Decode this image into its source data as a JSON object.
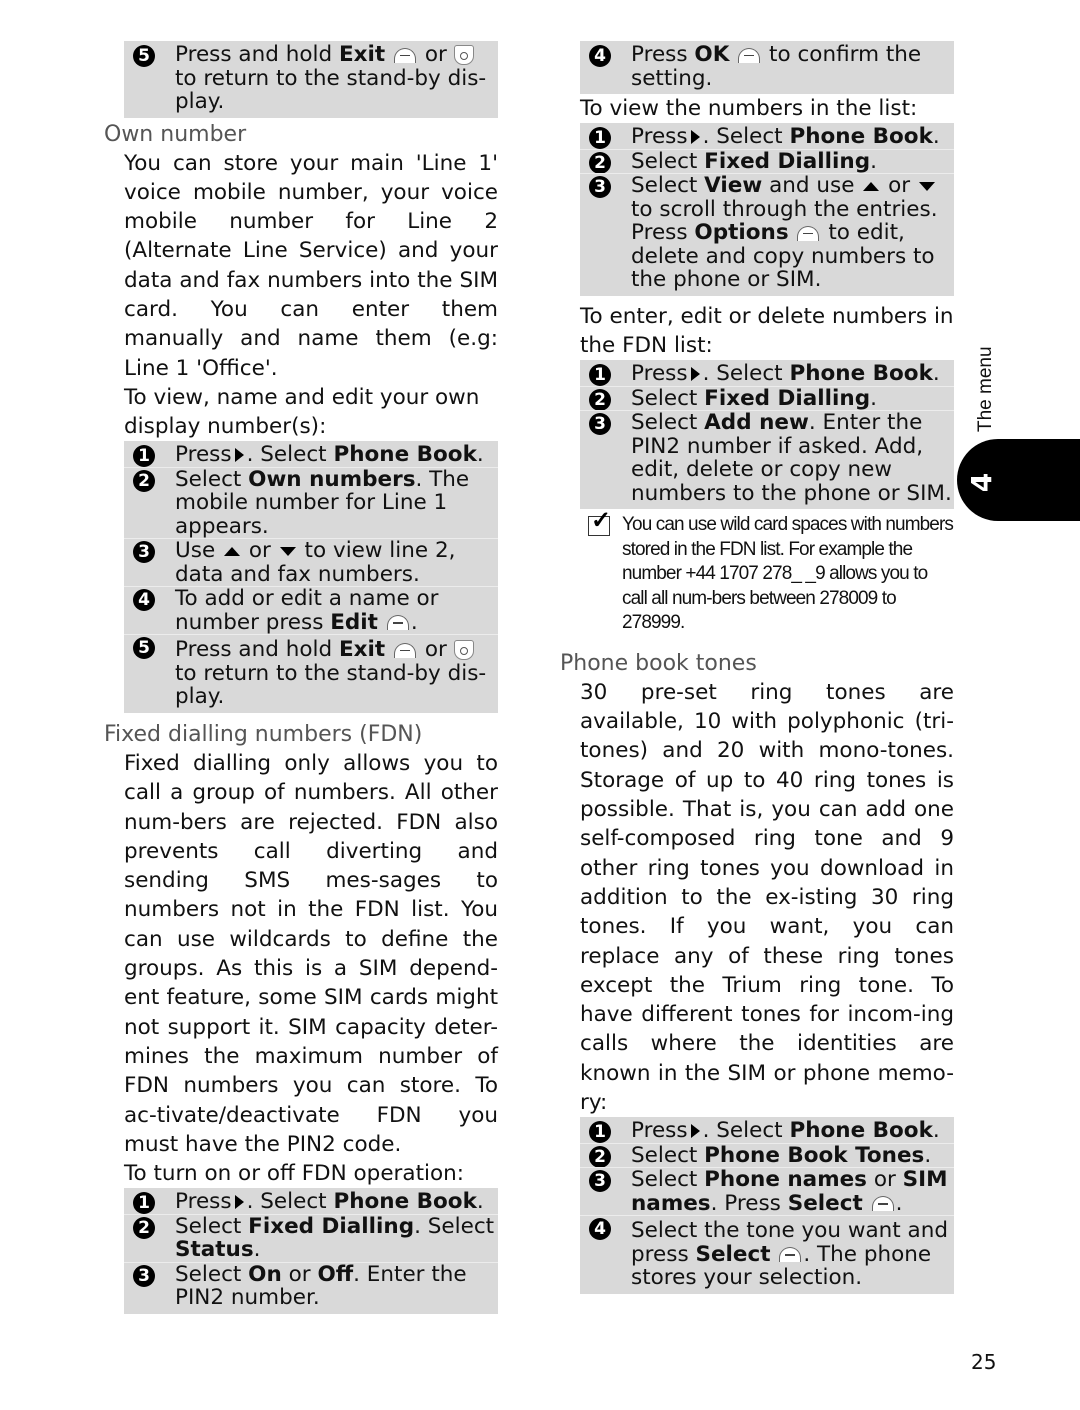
{
  "page_number": "25",
  "side_tab": {
    "label": "The menu",
    "chapter": "4"
  },
  "left": {
    "top_box": {
      "steps": [
        {
          "n": "5",
          "parts": [
            "Press and hold ",
            "Exit",
            " ",
            "or",
            " to return to the stand-by dis-play."
          ]
        }
      ]
    },
    "own_number": {
      "heading": "Own number",
      "para1": "You can store your main 'Line 1' voice mobile number, your voice mobile number for Line 2 (Alternate Line Service) and your data and fax numbers into the SIM card. You can enter them manually and name them (e.g: Line 1 'Office'.",
      "para2": "To view, name and edit your own display number(s):",
      "steps": {
        "s1": {
          "n": "1",
          "a": "Press",
          "b": ". Select ",
          "bold": "Phone Book",
          "c": "."
        },
        "s2": {
          "n": "2",
          "a": "Select ",
          "bold": "Own numbers",
          "c": ". The mobile number for Line 1 appears."
        },
        "s3": {
          "n": "3",
          "a": "Use",
          "b": "or",
          "c": "to view line 2, data and fax numbers."
        },
        "s4": {
          "n": "4",
          "a": "To add or edit a name or number press ",
          "bold": "Edit",
          "c": "."
        },
        "s5": {
          "n": "5",
          "a": "Press and hold ",
          "bold": "Exit",
          "b": "or",
          "c": "to return to the stand-by dis-play."
        }
      }
    },
    "fdn": {
      "heading": "Fixed dialling numbers (FDN)",
      "para1": "Fixed dialling only allows you to call a group of numbers. All other num-bers are rejected. FDN also prevents call diverting and sending SMS mes-sages to numbers not in the FDN list. You can use wildcards to define the groups. As this is a SIM depend-ent feature, some SIM cards might not support it. SIM capacity deter-mines the maximum number of FDN numbers you can store. To ac-tivate/deactivate FDN you must have the PIN2 code.",
      "para2": "To turn on or off FDN operation:",
      "steps": {
        "s1": {
          "n": "1",
          "a": "Press",
          "b": ". Select ",
          "bold": "Phone Book",
          "c": "."
        },
        "s2": {
          "n": "2",
          "a": "Select ",
          "bold": "Fixed Dialling",
          "b": ". Select ",
          "bold2": "Status",
          "c": "."
        },
        "s3": {
          "n": "3",
          "a": "Select ",
          "bold": "On",
          "b": " or ",
          "bold2": "Off",
          "c": ". Enter the PIN2 number."
        }
      }
    }
  },
  "right": {
    "top_box": {
      "s4": {
        "n": "4",
        "a": "Press ",
        "bold": "OK",
        "c": "to confirm the setting."
      }
    },
    "view_intro": "To view the numbers in the list:",
    "view_steps": {
      "s1": {
        "n": "1",
        "a": "Press",
        "b": ". Select ",
        "bold": "Phone Book",
        "c": "."
      },
      "s2": {
        "n": "2",
        "a": "Select ",
        "bold": "Fixed Dialling",
        "c": "."
      },
      "s3": {
        "n": "3",
        "a": "Select ",
        "bold": "View",
        "b": " and use",
        "or": "or",
        "c": "to scroll through the entries. Press ",
        "bold2": "Options",
        "d": "to edit, delete and copy numbers to the phone or SIM."
      }
    },
    "edit_intro": "To enter, edit or delete numbers in the FDN list:",
    "edit_steps": {
      "s1": {
        "n": "1",
        "a": "Press",
        "b": ". Select ",
        "bold": "Phone Book",
        "c": "."
      },
      "s2": {
        "n": "2",
        "a": "Select ",
        "bold": "Fixed Dialling",
        "c": "."
      },
      "s3": {
        "n": "3",
        "a": "Select ",
        "bold": "Add new",
        "c": ". Enter the PIN2 number if asked. Add, edit, delete or copy new numbers to the phone or SIM."
      }
    },
    "note": "You can use wild card spaces with numbers stored in the FDN list. For example the number +44 1707 278_ _9 allows you to call all num-bers between 278009 to 278999.",
    "tones": {
      "heading": "Phone book tones",
      "para": "30 pre-set ring tones are available, 10 with polyphonic (tri-tones) and 20 with mono-tones. Storage of up to 40 ring tones is possible. That is, you can add one self-composed ring tone and 9 other ring tones you download in addition to the ex-isting 30 ring tones. If you want, you can replace any of these ring tones except the Trium ring tone. To have different tones for incom-ing calls where the identities are known in the SIM or phone memo-ry:",
      "steps": {
        "s1": {
          "n": "1",
          "a": "Press",
          "b": ". Select ",
          "bold": "Phone Book",
          "c": "."
        },
        "s2": {
          "n": "2",
          "a": "Select ",
          "bold": "Phone Book Tones",
          "c": "."
        },
        "s3": {
          "n": "3",
          "a": "Select ",
          "bold": "Phone names",
          "b": " or ",
          "bold2": "SIM names",
          "c": ". Press ",
          "bold3": "Select",
          "d": "."
        },
        "s4": {
          "n": "4",
          "a": "Select the tone you want and press ",
          "bold": "Select",
          "c": ". The phone stores your selection."
        }
      }
    }
  }
}
